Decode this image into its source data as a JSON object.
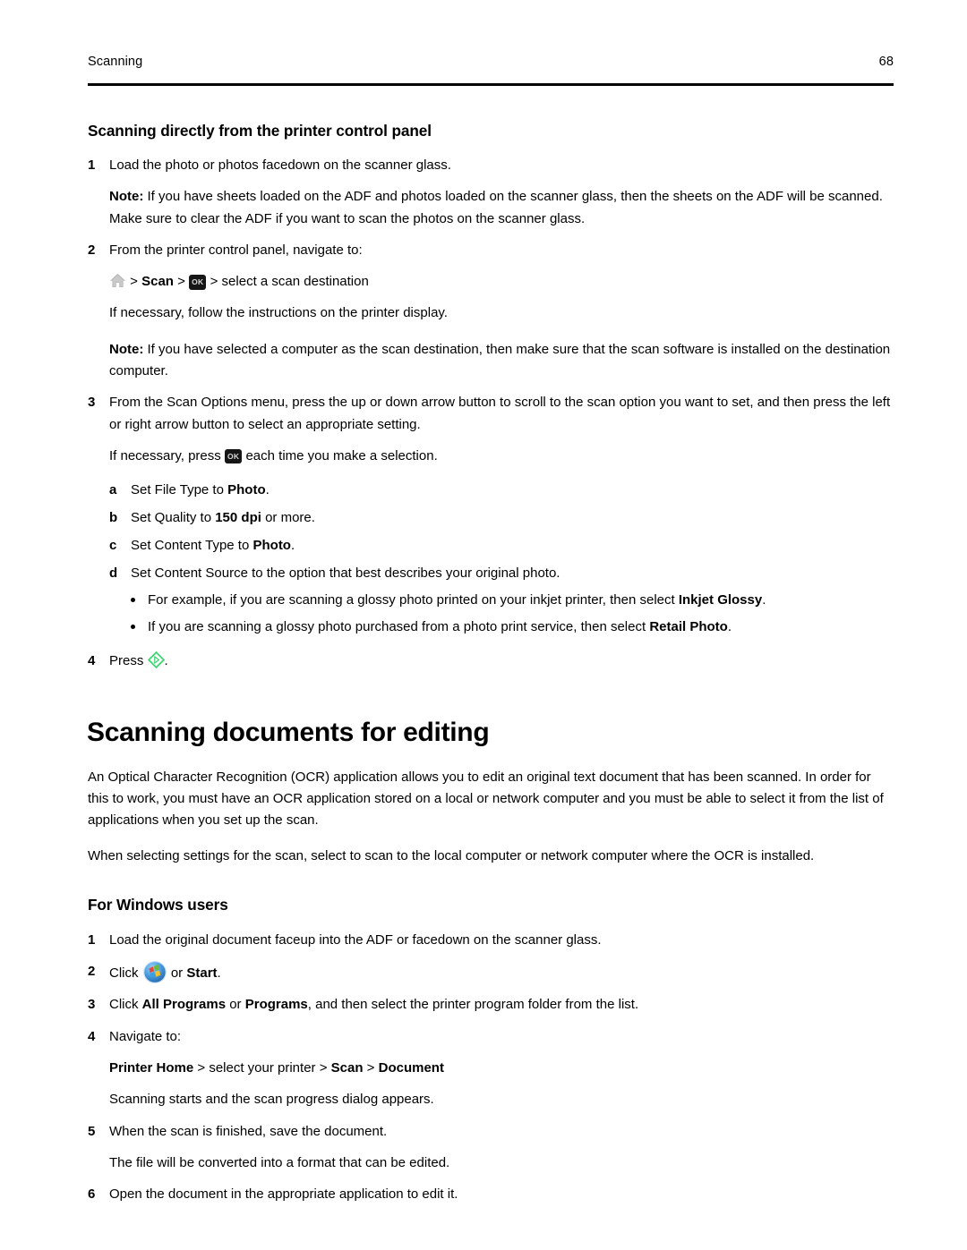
{
  "header": {
    "section": "Scanning",
    "page_number": "68"
  },
  "section1": {
    "heading": "Scanning directly from the printer control panel",
    "step1": {
      "num": "1",
      "text": "Load the photo or photos facedown on the scanner glass."
    },
    "note1": {
      "label": "Note:",
      "text": " If you have sheets loaded on the ADF and photos loaded on the scanner glass, then the sheets on the ADF will be scanned. Make sure to clear the ADF if you want to scan the photos on the scanner glass."
    },
    "step2": {
      "num": "2",
      "text": "From the printer control panel, navigate to:"
    },
    "nav_path": {
      "home_icon": "home-icon",
      "sep1": " > ",
      "scan_label": "Scan",
      "sep2": " > ",
      "ok_key": "OK",
      "sep3": " > ",
      "tail": "select a scan destination"
    },
    "follow_text": "If necessary, follow the instructions on the printer display.",
    "note2": {
      "label": "Note:",
      "text": " If you have selected a computer as the scan destination, then make sure that the scan software is installed on the destination computer."
    },
    "step3": {
      "num": "3",
      "text": "From the Scan Options menu, press the up or down arrow button to scroll to the scan option you want to set, and then press the left or right arrow button to select an appropriate setting."
    },
    "press_ok_line": {
      "before": "If necessary, press ",
      "ok_key": "OK",
      "after": " each time you make a selection."
    },
    "substeps": [
      {
        "letter": "a",
        "before": "Set File Type to ",
        "bold": "Photo",
        "after": "."
      },
      {
        "letter": "b",
        "before": "Set Quality to ",
        "bold": "150 dpi",
        "after": " or more."
      },
      {
        "letter": "c",
        "before": "Set Content Type to ",
        "bold": "Photo",
        "after": "."
      },
      {
        "letter": "d",
        "before": "Set Content Source to the option that best describes your original photo.",
        "bold": "",
        "after": ""
      }
    ],
    "bullets": [
      {
        "before": "For example, if you are scanning a glossy photo printed on your inkjet printer, then select ",
        "bold": "Inkjet Glossy",
        "after": "."
      },
      {
        "before": "If you are scanning a glossy photo purchased from a photo print service, then select ",
        "bold": "Retail Photo",
        "after": "."
      }
    ],
    "step4": {
      "num": "4",
      "before": "Press ",
      "icon": "start-button-icon",
      "after": "."
    }
  },
  "section2": {
    "heading": "Scanning documents for editing",
    "para1": "An Optical Character Recognition (OCR) application allows you to edit an original text document that has been scanned. In order for this to work, you must have an OCR application stored on a local or network computer and you must be able to select it from the list of applications when you set up the scan.",
    "para2": "When selecting settings for the scan, select to scan to the local computer or network computer where the OCR is installed.",
    "subheading": "For Windows users",
    "step1": {
      "num": "1",
      "text": "Load the original document faceup into the ADF or facedown on the scanner glass."
    },
    "step2": {
      "num": "2",
      "before": "Click ",
      "icon": "windows-start-orb-icon",
      "middle": " or ",
      "bold": "Start",
      "after": "."
    },
    "step3": {
      "num": "3",
      "before": "Click ",
      "bold1": "All Programs",
      "middle": " or ",
      "bold2": "Programs",
      "after": ", and then select the printer program folder from the list."
    },
    "step4": {
      "num": "4",
      "text": "Navigate to:"
    },
    "nav_path": {
      "printer_home": "Printer Home",
      "sep1": " > ",
      "select_printer": "select your printer",
      "sep2": " > ",
      "scan": "Scan",
      "sep3": " > ",
      "document": "Document"
    },
    "nav_result": "Scanning starts and the scan progress dialog appears.",
    "step5": {
      "num": "5",
      "text": "When the scan is finished, save the document."
    },
    "step5_result": "The file will be converted into a format that can be edited.",
    "step6": {
      "num": "6",
      "text": "Open the document in the appropriate application to edit it."
    }
  },
  "colors": {
    "text": "#000000",
    "ok_key_bg": "#161616",
    "ok_key_fg": "#d8d8d8",
    "home_icon": "#b0b0b0",
    "start_green": "#3cd672",
    "win_orb_blue": "#2f7fd0",
    "win_red": "#e8463a",
    "win_green": "#6cbb3c",
    "win_blue": "#3b9ede",
    "win_yellow": "#f5c22b"
  }
}
